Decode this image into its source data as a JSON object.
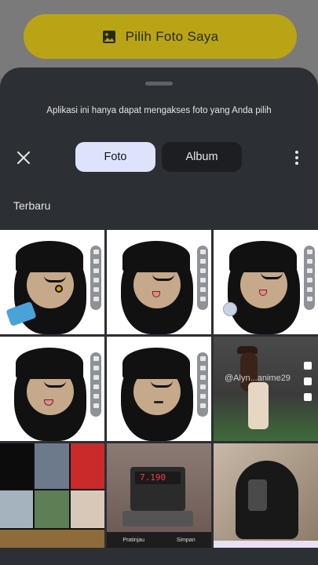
{
  "top_button": {
    "label": "Pilih Foto Saya",
    "icon": "image-icon"
  },
  "sheet": {
    "notice": "Aplikasi ini hanya dapat mengakses foto yang Anda pilih",
    "tabs": [
      {
        "label": "Foto",
        "selected": true
      },
      {
        "label": "Album",
        "selected": false
      }
    ],
    "close_icon": "close-icon",
    "more_icon": "more-vertical-icon",
    "section_label": "Terbaru"
  },
  "colors": {
    "sheet_bg": "#2c2f33",
    "tab_selected_bg": "#dde3fb",
    "tab_unselected_bg": "#1c1e22",
    "button_bg": "#b9a415"
  },
  "photos": {
    "count_visible": 9,
    "thumb6_caption": "@Alyn...anime29",
    "thumb8_buttons": [
      "Pratinjau",
      "Simpan"
    ]
  }
}
